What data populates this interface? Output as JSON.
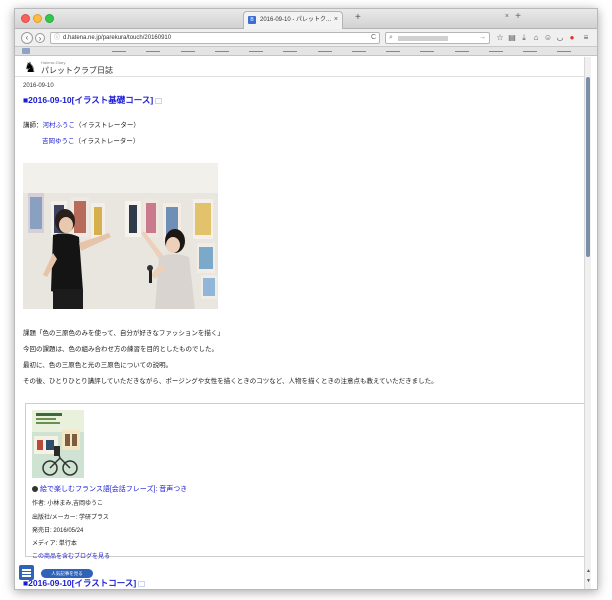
{
  "browser": {
    "tab_title": "2016-09-10 - パレットク...",
    "tab_close": "×",
    "new_tab": "+",
    "tabs_close": "×",
    "tabs_list": "+",
    "url": "d.hatena.ne.jp/parekura/touch/20160910",
    "reload": "C",
    "search_go": "→"
  },
  "header": {
    "logo_sub": "Hatena::Diary",
    "logo_title": "パレットクラブ日誌"
  },
  "entry": {
    "date": "2016-09-10",
    "title_mark": "■",
    "title": "2016-09-10[イラスト基礎コース]",
    "lecturer_label": "講師：",
    "lecturer1": "河村ふうこ",
    "lecturer1_role": "（イラストレーター）",
    "lecturer2": "吉岡ゆうこ",
    "lecturer2_role": "（イラストレーター）",
    "para1": "課題「色の三原色のみを使って、自分が好きなファッションを描く」",
    "para2": "今回の課題は、色の組み合わせ方の練習を目的としたものでした。",
    "para3": "最初に、色の三原色と光の三原色についての説明。",
    "para4": "その後、ひとりひとり講評していただきながら、ポージングや女性を描くときのコツなど、人物を描くときの注意点も教えていただきました。"
  },
  "book": {
    "title": "絵で楽しむフランス語[会話フレーズ]: 音声つき",
    "author": "作者: 小林まみ,吉岡ゆうこ",
    "publisher": "出版社/メーカー: 学研プラス",
    "release": "発売日: 2016/05/24",
    "media": "メディア: 単行本",
    "blog_link": "この商品を含むブログを見る"
  },
  "next_entry": {
    "title_mark": "■",
    "title": "2016-09-10[イラストコース]"
  },
  "ui": {
    "popular_button": "人気記事を見る"
  }
}
